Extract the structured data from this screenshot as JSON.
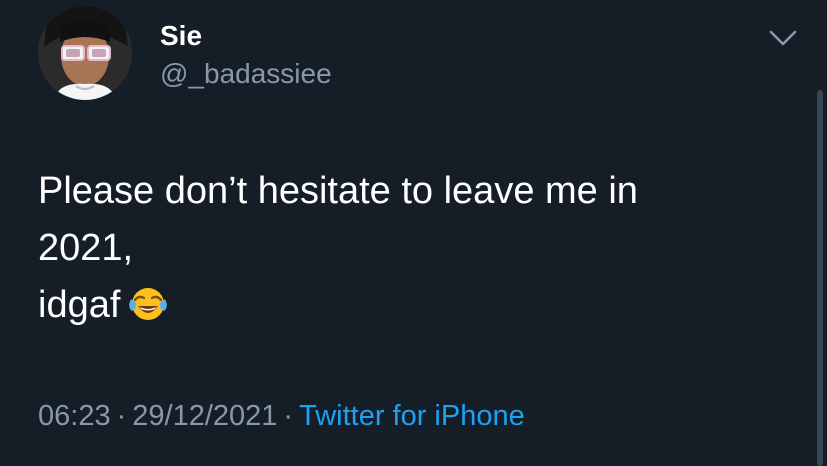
{
  "user": {
    "display_name": "Sie",
    "handle": "@_badassiee",
    "avatar_icon": "profile-photo"
  },
  "tweet": {
    "lines": [
      "Please don’t hesitate to leave me in",
      "2021,",
      "idgaf"
    ],
    "emoji": "face-with-tears-of-joy"
  },
  "meta": {
    "time": "06:23",
    "separator": "·",
    "date": "29/12/2021",
    "source": "Twitter for iPhone"
  },
  "icons": {
    "menu": "chevron-down-icon"
  },
  "colors": {
    "background": "#151d27",
    "secondary_text": "#8899a6",
    "link": "#1da1f2"
  }
}
